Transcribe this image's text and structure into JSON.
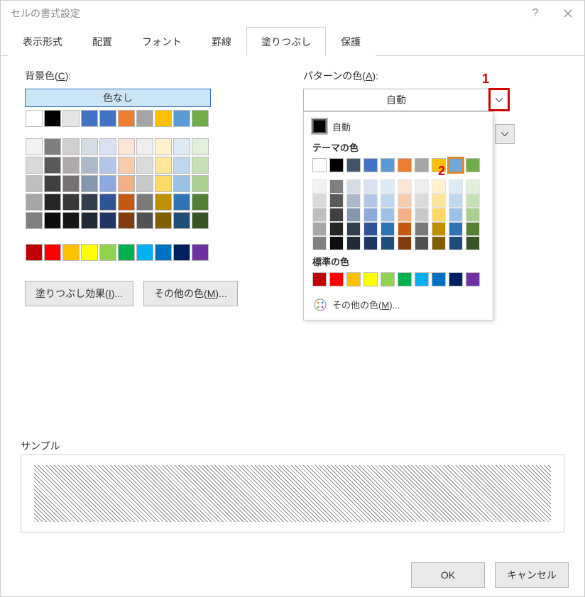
{
  "dialog": {
    "title": "セルの書式設定"
  },
  "tabs": [
    "表示形式",
    "配置",
    "フォント",
    "罫線",
    "塗りつぶし",
    "保護"
  ],
  "active_tab_index": 4,
  "left": {
    "label_html": "背景色(<u>C</u>):",
    "nocolor": "色なし",
    "grid_rows": [
      [
        "#ffffff",
        "#000000",
        "#e6e6e6",
        "#4472c4",
        "#4472c4",
        "#ed7d31",
        "#a5a5a5",
        "#ffc000",
        "#5b9bd5",
        "#70ad47"
      ],
      [
        "#f2f2f2",
        "#7f7f7f",
        "#d0cece",
        "#d6dce4",
        "#d9e1f2",
        "#fce4d6",
        "#ededed",
        "#fff2cc",
        "#ddebf7",
        "#e2efda"
      ],
      [
        "#d9d9d9",
        "#595959",
        "#aeaaaa",
        "#acb9ca",
        "#b4c6e7",
        "#f8cbad",
        "#dbdbdb",
        "#ffe699",
        "#bdd7ee",
        "#c6e0b4"
      ],
      [
        "#bfbfbf",
        "#404040",
        "#757171",
        "#8497b0",
        "#8ea9db",
        "#f4b084",
        "#c9c9c9",
        "#ffd966",
        "#9bc2e6",
        "#a9d08e"
      ],
      [
        "#a6a6a6",
        "#262626",
        "#3a3838",
        "#333f4f",
        "#305496",
        "#c65911",
        "#7b7b7b",
        "#bf8f00",
        "#2f75b5",
        "#548235"
      ],
      [
        "#808080",
        "#0d0d0d",
        "#161616",
        "#222b35",
        "#203764",
        "#833c0c",
        "#525252",
        "#806000",
        "#1f4e78",
        "#375623"
      ]
    ],
    "std_row": [
      "#c00000",
      "#ff0000",
      "#ffc000",
      "#ffff00",
      "#92d050",
      "#00b050",
      "#00b0f0",
      "#0070c0",
      "#002060",
      "#7030a0"
    ],
    "fill_effects_html": "塗りつぶし効果(<u>I</u>)...",
    "more_colors_html": "その他の色(<u>M</u>)..."
  },
  "right": {
    "label_html": "パターンの色(<u>A</u>):",
    "selected": "自動",
    "panel": {
      "auto": "自動",
      "theme_heading": "テーマの色",
      "theme_row": [
        "#ffffff",
        "#000000",
        "#44546a",
        "#4472c4",
        "#5b9bd5",
        "#ed7d31",
        "#a5a5a5",
        "#ffc000",
        "#6fa8dc",
        "#70ad47"
      ],
      "theme_highlight_index": 8,
      "theme_cols": [
        [
          "#f2f2f2",
          "#d9d9d9",
          "#bfbfbf",
          "#a6a6a6",
          "#808080"
        ],
        [
          "#7f7f7f",
          "#595959",
          "#404040",
          "#262626",
          "#0d0d0d"
        ],
        [
          "#d6dce4",
          "#acb9ca",
          "#8497b0",
          "#333f4f",
          "#222b35"
        ],
        [
          "#d9e1f2",
          "#b4c6e7",
          "#8ea9db",
          "#305496",
          "#203764"
        ],
        [
          "#ddebf7",
          "#bdd7ee",
          "#9bc2e6",
          "#2f75b5",
          "#1f4e78"
        ],
        [
          "#fce4d6",
          "#f8cbad",
          "#f4b084",
          "#c65911",
          "#833c0c"
        ],
        [
          "#ededed",
          "#dbdbdb",
          "#c9c9c9",
          "#7b7b7b",
          "#525252"
        ],
        [
          "#fff2cc",
          "#ffe699",
          "#ffd966",
          "#bf8f00",
          "#806000"
        ],
        [
          "#ddebf7",
          "#bdd7ee",
          "#9bc2e6",
          "#2f75b5",
          "#1f4e78"
        ],
        [
          "#e2efda",
          "#c6e0b4",
          "#a9d08e",
          "#548235",
          "#375623"
        ]
      ],
      "std_heading": "標準の色",
      "std_row": [
        "#c00000",
        "#ff0000",
        "#ffc000",
        "#ffff00",
        "#92d050",
        "#00b050",
        "#00b0f0",
        "#0070c0",
        "#002060",
        "#7030a0"
      ],
      "more_html": "その他の色(<u>M</u>)..."
    }
  },
  "annot": {
    "one": "1",
    "two": "2"
  },
  "sample_label": "サンプル",
  "footer": {
    "ok": "OK",
    "cancel": "キャンセル"
  }
}
